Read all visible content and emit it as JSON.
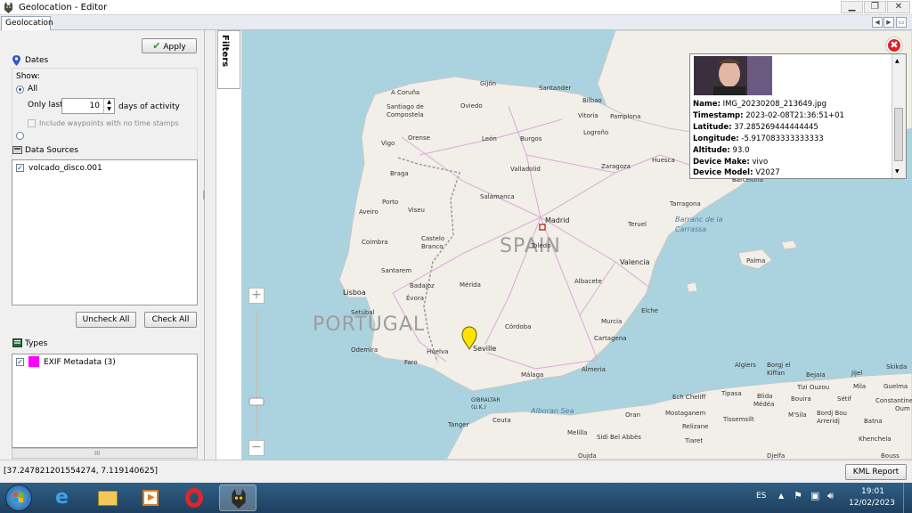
{
  "window": {
    "title": "Geolocation - Editor"
  },
  "tabs": [
    {
      "label": "Geolocation"
    }
  ],
  "left_panel": {
    "apply_label": "Apply",
    "dates": {
      "header": "Dates",
      "show_label": "Show:",
      "all_label": "All",
      "only_last_label": "Only last",
      "days_value": "10",
      "days_suffix": "days of activity",
      "include_no_timestamp_label": "Include waypoints with no time stamps"
    },
    "data_sources": {
      "header": "Data Sources",
      "items": [
        {
          "label": "volcado_disco.001",
          "checked": true
        }
      ]
    },
    "uncheck_all_label": "Uncheck All",
    "check_all_label": "Check All",
    "types": {
      "header": "Types",
      "items": [
        {
          "label": "EXIF Metadata (3)",
          "color": "#ff00ff",
          "checked": true
        }
      ]
    },
    "scroll_hint": "III"
  },
  "filters_tab": {
    "label": "Filters"
  },
  "map": {
    "countries": [
      {
        "label": "SPAIN"
      },
      {
        "label": "PORTUGAL"
      }
    ],
    "seas": [
      {
        "label": "Alboran Sea"
      },
      {
        "label": "Barranc de la Carrassa"
      }
    ],
    "cities": [
      {
        "label": "Gijón"
      },
      {
        "label": "Santander"
      },
      {
        "label": "A Coruña"
      },
      {
        "label": "Santiago de Compostela"
      },
      {
        "label": "Oviedo"
      },
      {
        "label": "Bilbao"
      },
      {
        "label": "Vitoria"
      },
      {
        "label": "Pamplona"
      },
      {
        "label": "León"
      },
      {
        "label": "Burgos"
      },
      {
        "label": "Logroño"
      },
      {
        "label": "Vigo"
      },
      {
        "label": "Orense"
      },
      {
        "label": "Valladolid"
      },
      {
        "label": "Zaragoza"
      },
      {
        "label": "Huesca"
      },
      {
        "label": "Braga"
      },
      {
        "label": "Salamanca"
      },
      {
        "label": "Porto"
      },
      {
        "label": "Viseu"
      },
      {
        "label": "Madrid"
      },
      {
        "label": "Teruel"
      },
      {
        "label": "Tarragona"
      },
      {
        "label": "Barcelona"
      },
      {
        "label": "Aveiro"
      },
      {
        "label": "Coimbra"
      },
      {
        "label": "Castelo Branco"
      },
      {
        "label": "Toledo"
      },
      {
        "label": "Santarem"
      },
      {
        "label": "Valencia"
      },
      {
        "label": "Palma"
      },
      {
        "label": "Lisboa"
      },
      {
        "label": "Badajoz"
      },
      {
        "label": "Mérida"
      },
      {
        "label": "Albacete"
      },
      {
        "label": "Évora"
      },
      {
        "label": "Setúbal"
      },
      {
        "label": "Elche"
      },
      {
        "label": "Murcia"
      },
      {
        "label": "Córdoba"
      },
      {
        "label": "Cartagena"
      },
      {
        "label": "Odemira"
      },
      {
        "label": "Seville"
      },
      {
        "label": "Huelva"
      },
      {
        "label": "Faro"
      },
      {
        "label": "Almeria"
      },
      {
        "label": "Málaga"
      },
      {
        "label": "Algiers"
      },
      {
        "label": "Borgj el Kiffan"
      },
      {
        "label": "Bejaia"
      },
      {
        "label": "Jijel"
      },
      {
        "label": "Skikda"
      },
      {
        "label": "GIBRALTAR (U.K.)"
      },
      {
        "label": "Ceuta"
      },
      {
        "label": "Tanger"
      },
      {
        "label": "Oran"
      },
      {
        "label": "Ech Cheliff"
      },
      {
        "label": "Tipasa"
      },
      {
        "label": "Blida"
      },
      {
        "label": "Médéa"
      },
      {
        "label": "Tizi Ouzou"
      },
      {
        "label": "Mila"
      },
      {
        "label": "Guelma"
      },
      {
        "label": "Mostaganem"
      },
      {
        "label": "Bouira"
      },
      {
        "label": "Sétif"
      },
      {
        "label": "Constantine"
      },
      {
        "label": "Oum"
      },
      {
        "label": "Relizane"
      },
      {
        "label": "Tissemsilt"
      },
      {
        "label": "M'Sila"
      },
      {
        "label": "Bordj Bou Arreridj"
      },
      {
        "label": "Batna"
      },
      {
        "label": "Khenchela"
      },
      {
        "label": "Melilla"
      },
      {
        "label": "Sidi Bel Abbès"
      },
      {
        "label": "Tiaret"
      },
      {
        "label": "Oujda"
      },
      {
        "label": "Djelfa"
      },
      {
        "label": "Bouss"
      }
    ],
    "zoom_in_label": "+",
    "zoom_out_label": "−"
  },
  "popup": {
    "close_label": "✖",
    "fields": [
      {
        "label": "Name:",
        "value": "IMG_20230208_213649.jpg"
      },
      {
        "label": "Timestamp:",
        "value": "2023-02-08T21:36:51+01"
      },
      {
        "label": "Latitude:",
        "value": "37.285269444444445"
      },
      {
        "label": "Longitude:",
        "value": "-5.917083333333333"
      },
      {
        "label": "Altitude:",
        "value": "93.0"
      },
      {
        "label": "Device Make:",
        "value": "vivo"
      },
      {
        "label": "Device Model:",
        "value": "V2027"
      }
    ]
  },
  "status": {
    "coordinates": "[37.247821201554274, 7.119140625]",
    "kml_report_label": "KML Report"
  },
  "taskbar": {
    "language": "ES",
    "time": "19:01",
    "date": "12/02/2023"
  }
}
